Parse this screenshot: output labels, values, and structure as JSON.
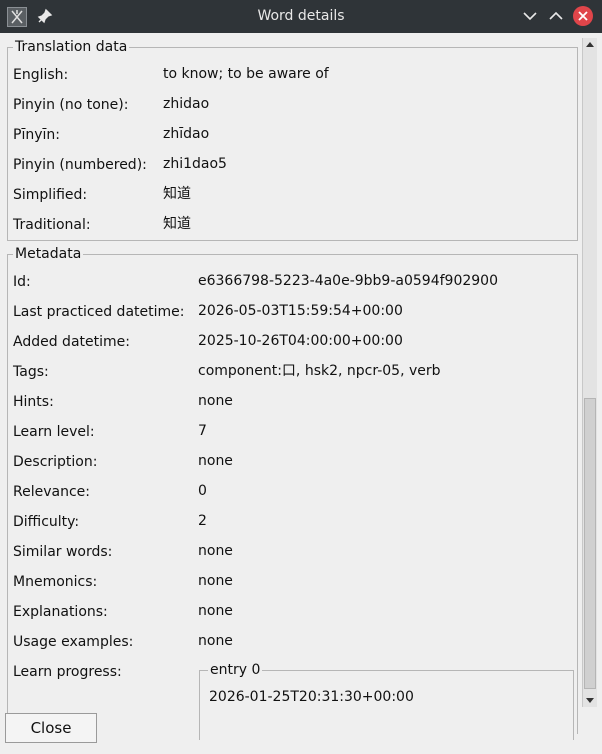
{
  "window": {
    "title": "Word details",
    "close_button": "Close"
  },
  "translation": {
    "legend": "Translation data",
    "rows": [
      {
        "label": "English:",
        "value": "to know; to be aware of"
      },
      {
        "label": "Pinyin (no tone):",
        "value": "zhidao"
      },
      {
        "label": "Pīnyīn:",
        "value": "zhīdao"
      },
      {
        "label": "Pinyin (numbered):",
        "value": "zhi1dao5"
      },
      {
        "label": "Simplified:",
        "value": "知道"
      },
      {
        "label": "Traditional:",
        "value": "知道"
      }
    ]
  },
  "metadata": {
    "legend": "Metadata",
    "rows": [
      {
        "label": "Id:",
        "value": "e6366798-5223-4a0e-9bb9-a0594f902900"
      },
      {
        "label": "Last practiced datetime:",
        "value": "2026-05-03T15:59:54+00:00"
      },
      {
        "label": "Added datetime:",
        "value": "2025-10-26T04:00:00+00:00"
      },
      {
        "label": "Tags:",
        "value": "component:口, hsk2, npcr-05, verb"
      },
      {
        "label": "Hints:",
        "value": "none"
      },
      {
        "label": "Learn level:",
        "value": "7"
      },
      {
        "label": "Description:",
        "value": "none"
      },
      {
        "label": "Relevance:",
        "value": "0"
      },
      {
        "label": "Difficulty:",
        "value": "2"
      },
      {
        "label": "Similar words:",
        "value": "none"
      },
      {
        "label": "Mnemonics:",
        "value": "none"
      },
      {
        "label": "Explanations:",
        "value": "none"
      },
      {
        "label": "Usage examples:",
        "value": "none"
      }
    ],
    "learn_progress": {
      "label": "Learn progress:",
      "entry_legend": "entry 0",
      "entry_value": "2026-01-25T20:31:30+00:00"
    }
  },
  "colors": {
    "titlebar": "#2f3438",
    "close_circle": "#e0454a",
    "window_bg": "#efefef"
  },
  "icons": {
    "app": "app-icon",
    "pin": "pin-icon",
    "minimize": "chevron-down-icon",
    "maximize": "chevron-up-icon",
    "close": "close-icon"
  }
}
